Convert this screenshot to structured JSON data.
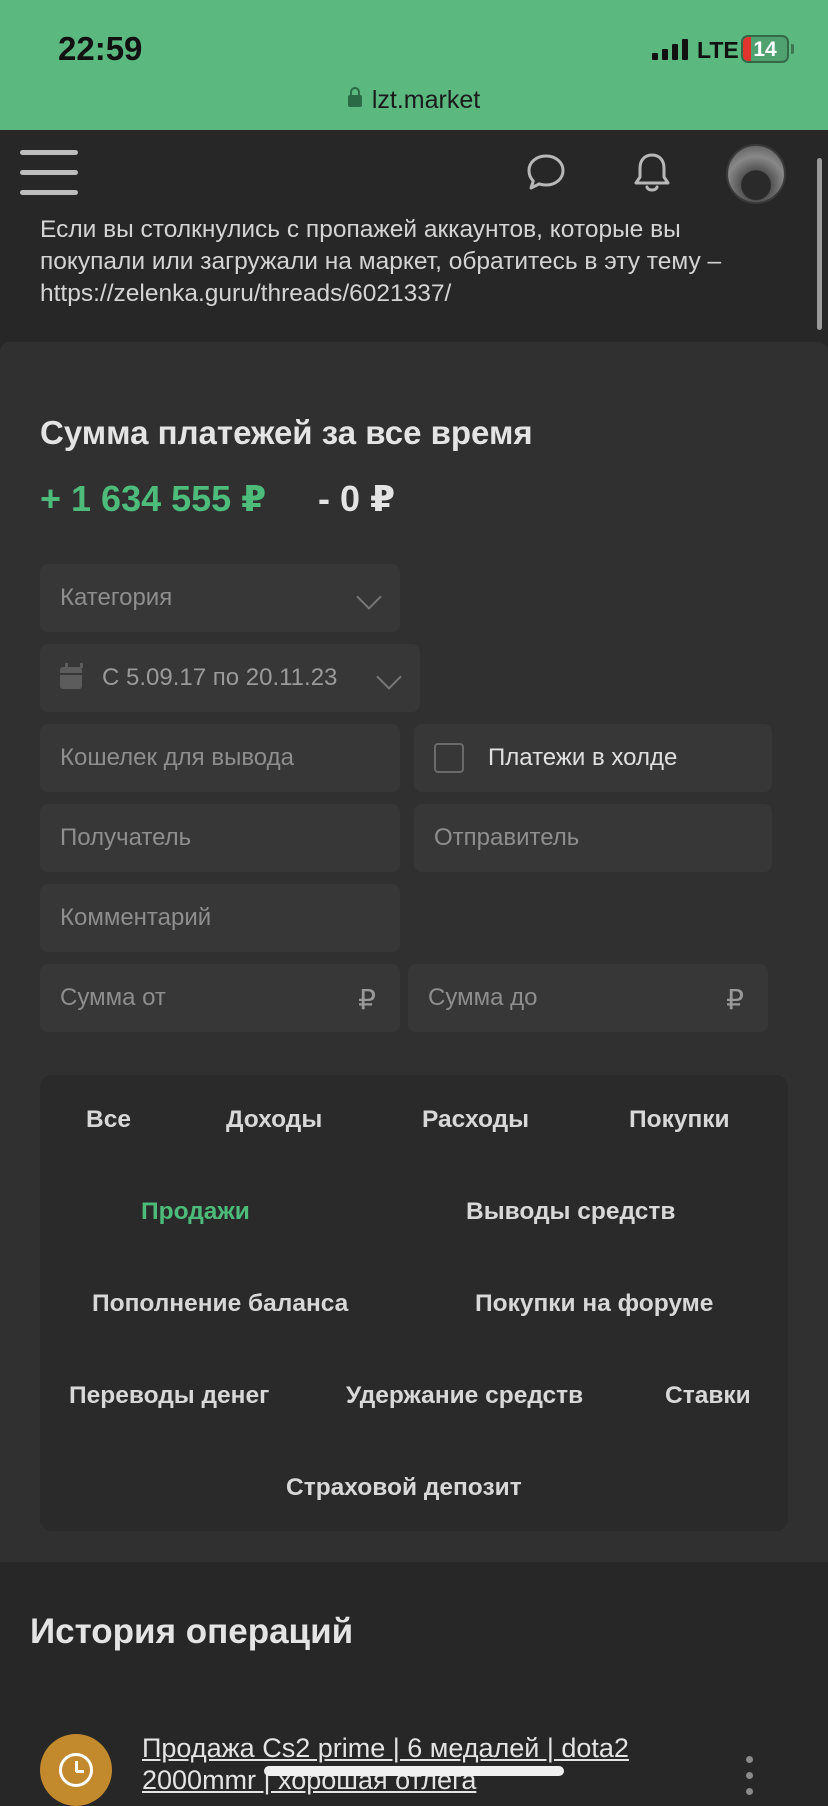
{
  "status_bar": {
    "time": "22:59",
    "network": "LTE",
    "battery": "14",
    "url": "lzt.market"
  },
  "header": {
    "menu_icon": "hamburger-icon",
    "chat_icon": "chat-bubble-icon",
    "notifications_icon": "bell-icon"
  },
  "notice": {
    "text": "Если вы столкнулись с пропажей аккаунтов, которые вы покупали или загружали на маркет, обратитесь в эту тему – https://zelenka.guru/threads/6021337/"
  },
  "summary": {
    "title": "Сумма платежей за все время",
    "income": "+ 1 634 555 ₽",
    "expense": "- 0 ₽"
  },
  "filters": {
    "category_placeholder": "Категория",
    "date_range": "С 5.09.17 по 20.11.23",
    "wallet_placeholder": "Кошелек для вывода",
    "hold_label": "Платежи в холде",
    "recipient_placeholder": "Получатель",
    "sender_placeholder": "Отправитель",
    "comment_placeholder": "Комментарий",
    "amount_from_placeholder": "Сумма от",
    "amount_to_placeholder": "Сумма до",
    "currency": "₽"
  },
  "tabs": {
    "all": "Все",
    "income": "Доходы",
    "expenses": "Расходы",
    "purchases": "Покупки",
    "sales": "Продажи",
    "withdrawals": "Выводы средств",
    "topup": "Пополнение баланса",
    "forum_purchases": "Покупки на форуме",
    "transfers": "Переводы денег",
    "holds": "Удержание средств",
    "bets": "Ставки",
    "insurance": "Страховой депозит",
    "active": "Продажи"
  },
  "history": {
    "title": "История операций",
    "items": [
      {
        "icon": "clock-icon",
        "title": "Продажа Cs2 prime | 6 медалей | dota2 2000mmr | хорошая отлега"
      }
    ]
  },
  "colors": {
    "accent_green": "#4dbb7a",
    "status_bar": "#5bb87f",
    "pending_orange": "#c38a2d"
  }
}
